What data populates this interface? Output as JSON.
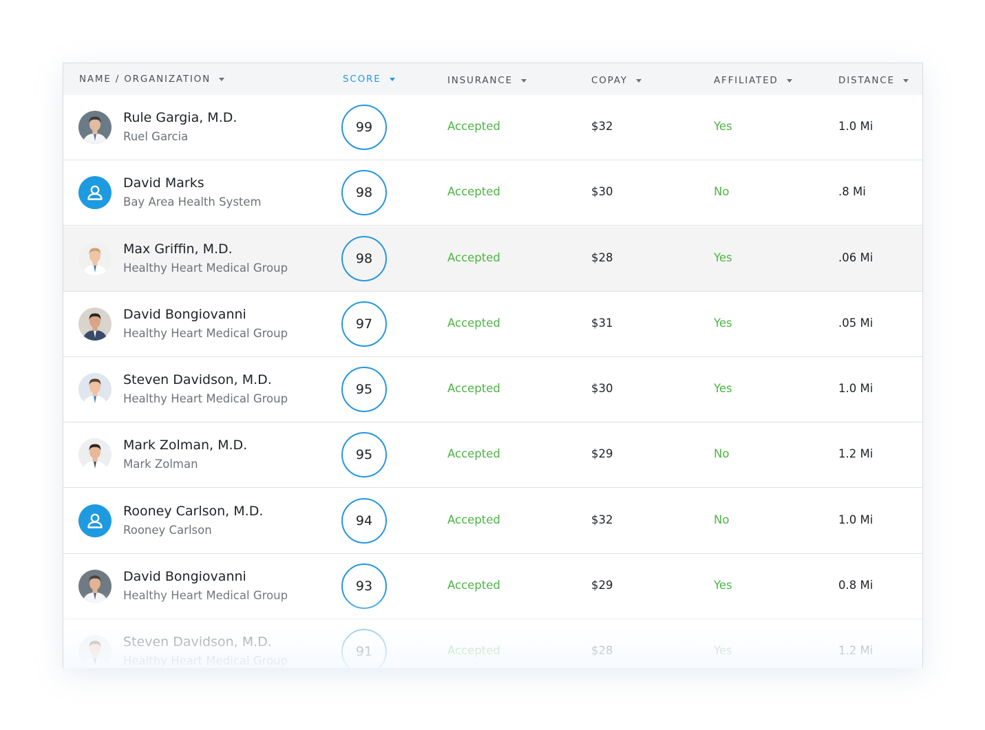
{
  "table": {
    "columns": [
      {
        "label": "NAME / ORGANIZATION",
        "active": false
      },
      {
        "label": "SCORE",
        "active": true
      },
      {
        "label": "INSURANCE",
        "active": false
      },
      {
        "label": "COPAY",
        "active": false
      },
      {
        "label": "AFFILIATED",
        "active": false
      },
      {
        "label": "DISTANCE",
        "active": false
      }
    ],
    "rows": [
      {
        "name": "Rule Gargia, M.D.",
        "org": "Ruel Garcia",
        "score": "99",
        "insurance": "Accepted",
        "copay": "$32",
        "affiliated": "Yes",
        "distance": "1.0 Mi",
        "avatar": "photo-doctor"
      },
      {
        "name": "David Marks",
        "org": "Bay Area Health System",
        "score": "98",
        "insurance": "Accepted",
        "copay": "$30",
        "affiliated": "No",
        "distance": ".8 Mi",
        "avatar": "person-icon"
      },
      {
        "name": "Max Griffin, M.D.",
        "org": "Healthy Heart Medical Group",
        "score": "98",
        "insurance": "Accepted",
        "copay": "$28",
        "affiliated": "Yes",
        "distance": ".06 Mi",
        "avatar": "photo-doctor"
      },
      {
        "name": "David Bongiovanni",
        "org": "Healthy Heart Medical Group",
        "score": "97",
        "insurance": "Accepted",
        "copay": "$31",
        "affiliated": "Yes",
        "distance": ".05 Mi",
        "avatar": "photo-doctor"
      },
      {
        "name": "Steven Davidson, M.D.",
        "org": "Healthy Heart Medical Group",
        "score": "95",
        "insurance": "Accepted",
        "copay": "$30",
        "affiliated": "Yes",
        "distance": "1.0 Mi",
        "avatar": "photo-doctor"
      },
      {
        "name": "Mark Zolman, M.D.",
        "org": "Mark Zolman",
        "score": "95",
        "insurance": "Accepted",
        "copay": "$29",
        "affiliated": "No",
        "distance": "1.2 Mi",
        "avatar": "photo-doctor"
      },
      {
        "name": "Rooney Carlson, M.D.",
        "org": "Rooney Carlson",
        "score": "94",
        "insurance": "Accepted",
        "copay": "$32",
        "affiliated": "No",
        "distance": "1.0 Mi",
        "avatar": "person-icon"
      },
      {
        "name": "David Bongiovanni",
        "org": "Healthy Heart Medical Group",
        "score": "93",
        "insurance": "Accepted",
        "copay": "$29",
        "affiliated": "Yes",
        "distance": "0.8 Mi",
        "avatar": "photo-doctor"
      },
      {
        "name": "Steven Davidson, M.D.",
        "org": "Healthy Heart Medical Group",
        "score": "91",
        "insurance": "Accepted",
        "copay": "$28",
        "affiliated": "Yes",
        "distance": "1.2 Mi",
        "avatar": "photo-doctor"
      }
    ]
  },
  "colors": {
    "accent": "#1c9be0",
    "positive": "#4bb543",
    "highlight_row": "#f4f4f4"
  }
}
